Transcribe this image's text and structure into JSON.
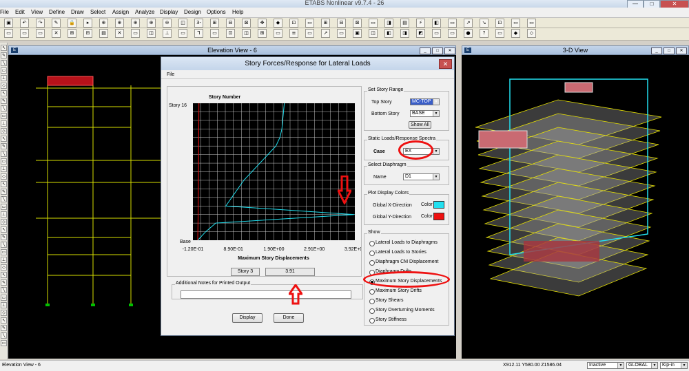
{
  "app": {
    "title": "ETABS Nonlinear v9.7.4 - 26"
  },
  "menu": [
    "File",
    "Edit",
    "View",
    "Define",
    "Draw",
    "Select",
    "Assign",
    "Analyze",
    "Display",
    "Design",
    "Options",
    "Help"
  ],
  "toolbar1": [
    "▣",
    "↶",
    "↷",
    "✎",
    "🔒",
    "▸",
    "⊕",
    "⊕",
    "⊕",
    "⊕",
    "⊖",
    "◫",
    "3-d",
    "⊞",
    "⊟",
    "⊠",
    "✥",
    "◆",
    "⊡",
    "▭",
    "⊞",
    "⊟",
    "⊠",
    "▭",
    "◨",
    "▤",
    "⚡",
    "◧",
    "▭",
    "↗",
    "↘",
    "⊡",
    "▭",
    "▭"
  ],
  "toolbar2": [
    "▭",
    "▭",
    "▭",
    "✕",
    "⊞",
    "⊟",
    "▤",
    "✕",
    "▭",
    "◫",
    "⊥",
    "▭",
    "Ꞁ",
    "▭",
    "⊡",
    "◫",
    "⊞",
    "▭",
    "≡",
    "▭",
    "↗",
    "▭",
    "▣",
    "◫",
    "◧",
    "◨",
    "◩",
    "▭",
    "▭",
    "●",
    "?",
    "▭",
    "◆",
    "◇"
  ],
  "windows": {
    "elevation": {
      "title": "Elevation View - 6"
    },
    "view3d": {
      "title": "3-D View"
    }
  },
  "dialog": {
    "title": "Story Forces/Response for Lateral Loads",
    "menu_file": "File",
    "close": "✕",
    "plot": {
      "title": "Story Number",
      "top_story_label": "Story 16",
      "base_label": "Base",
      "x_ticks": [
        "-1.20E-01",
        "8.90E-01",
        "1.90E+00",
        "2.91E+00",
        "3.92E+00"
      ],
      "xlabel": "Maximum Story Displacements",
      "readout_story": "Story 3",
      "readout_value": "3.91"
    },
    "notes_label": "Additional Notes for Printed Output",
    "display_button": "Display",
    "done_button": "Done",
    "story_range": {
      "group": "Set Story Range",
      "top_label": "Top Story",
      "top_value": "MC-TOP",
      "bottom_label": "Bottom Story",
      "bottom_value": "BASE",
      "show_all": "Show All"
    },
    "static_loads": {
      "group": "Static Loads/Response Spectra",
      "case_label": "Case",
      "case_value": "EX"
    },
    "diaphragm": {
      "group": "Select  Diaphragm",
      "name_label": "Name",
      "name_value": "D1"
    },
    "colors": {
      "group": "Plot Display Colors",
      "x_label": "Global X-Direction",
      "y_label": "Global Y-Direction",
      "color_word": "Color",
      "x_color": "#22e0f0",
      "y_color": "#ee1111"
    },
    "show": {
      "group": "Show",
      "selected_index": 4,
      "options": [
        "Lateral Loads to Diaphragms",
        "Lateral Loads to Stories",
        "Diaphragm CM Displacement",
        "Diaphragm Drifts",
        "Maximum Story Displacements",
        "Maximum Story Drifts",
        "Story Shears",
        "Story Overturning Moments",
        "Story Stiffness"
      ]
    }
  },
  "status": {
    "left": "Elevation View - 6",
    "coords": "X912.11  Y580.00  Z1586.04",
    "mode": "Inactive",
    "coord_sys": "GLOBAL",
    "units": "Kip-in"
  },
  "chart_data": {
    "type": "line",
    "title": "Story Number",
    "xlabel": "Maximum Story Displacements",
    "ylabel": "",
    "x_ticks": [
      -0.12,
      0.89,
      1.9,
      2.91,
      3.92
    ],
    "xlim": [
      -0.12,
      3.92
    ],
    "y_ticks": [
      "Base",
      "Story 16"
    ],
    "grid": true,
    "series": [
      {
        "name": "Global X-Direction",
        "color": "#22e0f0",
        "points": [
          [
            0.0,
            0
          ],
          [
            0.2,
            1
          ],
          [
            0.45,
            2
          ],
          [
            3.91,
            3
          ],
          [
            0.7,
            4
          ],
          [
            0.85,
            5
          ],
          [
            1.0,
            6
          ],
          [
            1.15,
            7
          ],
          [
            1.35,
            8
          ],
          [
            1.55,
            9
          ],
          [
            1.75,
            10
          ],
          [
            1.95,
            11
          ],
          [
            2.05,
            12
          ],
          [
            2.1,
            13
          ],
          [
            2.12,
            14
          ],
          [
            2.14,
            15
          ],
          [
            2.16,
            16
          ]
        ]
      },
      {
        "name": "Global Y-Direction",
        "color": "#ee1111",
        "points": [
          [
            0.0,
            0
          ],
          [
            0.01,
            3
          ],
          [
            0.02,
            8
          ],
          [
            0.03,
            16
          ]
        ]
      }
    ]
  }
}
